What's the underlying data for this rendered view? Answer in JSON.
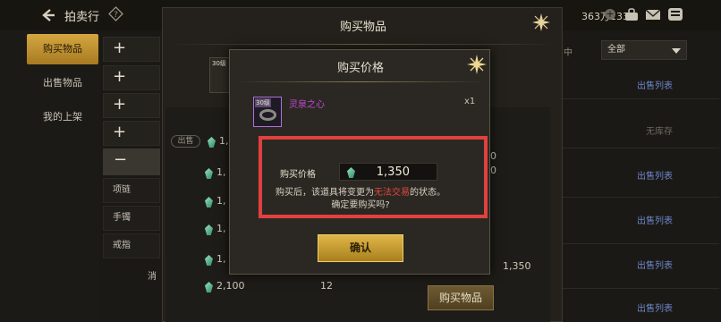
{
  "topbar": {
    "title": "拍卖行",
    "currency": "363万1330",
    "plus": "+"
  },
  "leftnav": {
    "items": [
      {
        "label": "购买物品",
        "active": true
      },
      {
        "label": "出售物品",
        "active": false
      },
      {
        "label": "我的上架",
        "active": false
      }
    ]
  },
  "categories": {
    "plus_symbol": "+",
    "minus_symbol": "−",
    "subs": [
      "项链",
      "手镯",
      "戒指"
    ],
    "more": "消"
  },
  "right": {
    "filter_label": "售中",
    "select_value": "全部",
    "sell_list": "出售列表",
    "no_stock": "无库存",
    "values": [
      "0",
      "0",
      "1,350"
    ]
  },
  "list": {
    "sell_tag": "出售",
    "prices": [
      "1,",
      "1,",
      "1,",
      "1,",
      "1,",
      "2,100"
    ],
    "last_qty": "12"
  },
  "dialog1": {
    "title": "购买物品",
    "thumb_level": "30级",
    "buy_button": "购买物品"
  },
  "dialog2": {
    "title": "购买价格",
    "item_level": "30级",
    "item_name": "灵泉之心",
    "item_qty": "x1",
    "price_label": "购买价格",
    "price_value": "1,350",
    "warn_before": "购买后，该道具将变更为",
    "warn_red": "无法交易",
    "warn_after": "的状态。",
    "confirm_question": "确定要购买吗?",
    "ok_button": "确认"
  },
  "colors": {
    "accent_gold": "#d4a741",
    "item_purple": "#c347d8",
    "warn_red": "#e2463c",
    "link_blue": "#6d87c9",
    "highlight_red": "#e0413f"
  }
}
